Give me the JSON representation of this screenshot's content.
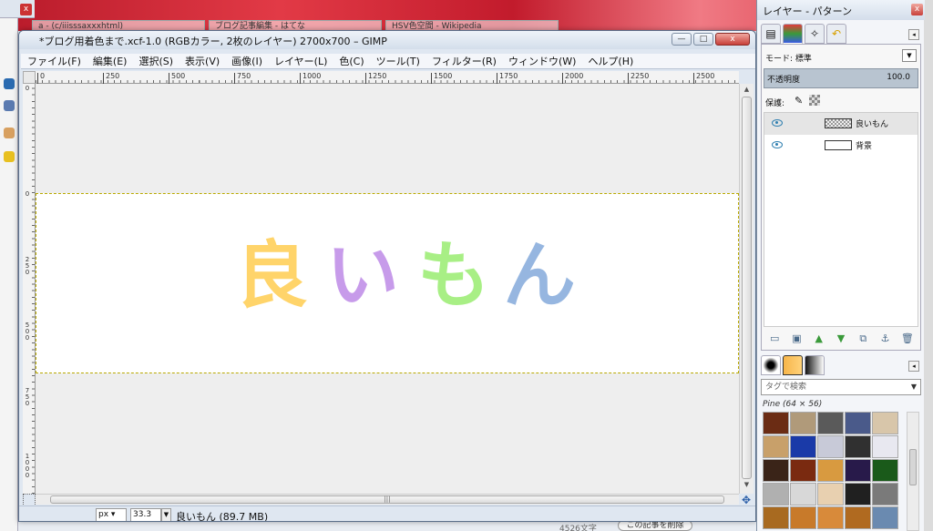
{
  "background": {
    "tabs": [
      "a - (c/iiisssaxxxhtml)",
      "ブログ記事編集 - はてな",
      "HSV色空間 - Wikipedia"
    ],
    "left_close": "x",
    "bottom_text": "4526文字",
    "bottom_button": "この記事を削除"
  },
  "gimp_window": {
    "title": "*ブログ用着色まで.xcf-1.0 (RGBカラー, 2枚のレイヤー) 2700x700 – GIMP",
    "buttons": {
      "minimize": "—",
      "maximize": "□",
      "close": "x"
    },
    "menu": [
      "ファイル(F)",
      "編集(E)",
      "選択(S)",
      "表示(V)",
      "画像(I)",
      "レイヤー(L)",
      "色(C)",
      "ツール(T)",
      "フィルター(R)",
      "ウィンドウ(W)",
      "ヘルプ(H)"
    ],
    "ruler_h": [
      "0",
      "250",
      "500",
      "750",
      "1000",
      "1250",
      "1500",
      "1750",
      "2000",
      "2250",
      "2500"
    ],
    "ruler_v": [
      "0",
      "0",
      "250",
      "500",
      "750",
      "1000"
    ],
    "canvas_text": [
      {
        "char": "良",
        "color": "#ffd46a"
      },
      {
        "char": "い",
        "color": "#c79bea"
      },
      {
        "char": "も",
        "color": "#a8ef85"
      },
      {
        "char": "ん",
        "color": "#96b6e0"
      }
    ],
    "status": {
      "unit": "px",
      "zoom": "33.3 %",
      "info": "良いもん (89.7 MB)"
    }
  },
  "dock": {
    "title": "レイヤー - パターン",
    "close": "x",
    "layers": {
      "mode_label": "モード: 標準",
      "opacity_label": "不透明度",
      "opacity_value": "100.0",
      "lock_label": "保護:",
      "items": [
        {
          "name": "良いもん",
          "selected": true
        },
        {
          "name": "背景",
          "selected": false
        }
      ]
    },
    "patterns": {
      "search_placeholder": "タグで検索",
      "selected_name": "Pine (64 × 56)",
      "swatches": [
        "#6b2c14",
        "#b09a7a",
        "#5a5a5a",
        "#4a5a8a",
        "#d8c6aa",
        "#c8a06a",
        "#1a3aa8",
        "#c8cad8",
        "#303030",
        "#e8e8f0",
        "#3a2418",
        "#7a2a10",
        "#d89a40",
        "#281a4a",
        "#1a5a1a",
        "#b0b0b0",
        "#d8d8d8",
        "#e8d0b0",
        "#202020",
        "#7a7a7a",
        "#a86a20",
        "#c87a2a",
        "#d88a3a",
        "#b06a20",
        "#6a8ab0"
      ]
    }
  }
}
